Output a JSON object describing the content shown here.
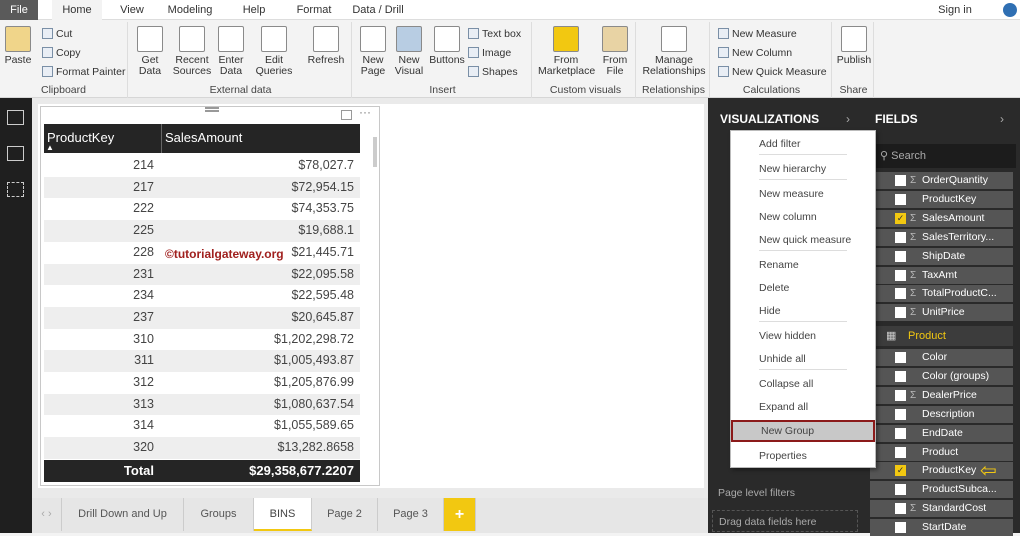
{
  "ribbon_tabs": [
    "File",
    "Home",
    "View",
    "Modeling",
    "Help",
    "Format",
    "Data / Drill"
  ],
  "sign_in": "Sign in",
  "clipboard": {
    "paste": "Paste",
    "cut": "Cut",
    "copy": "Copy",
    "format_painter": "Format Painter",
    "label": "Clipboard"
  },
  "external": {
    "get_data": "Get Data",
    "recent": "Recent Sources",
    "enter": "Enter Data",
    "edit": "Edit Queries",
    "refresh": "Refresh",
    "label": "External data"
  },
  "insert": {
    "new_page": "New Page",
    "new_visual": "New Visual",
    "buttons": "Buttons",
    "text_box": "Text box",
    "image": "Image",
    "shapes": "Shapes",
    "label": "Insert"
  },
  "custom": {
    "market": "From Marketplace",
    "file": "From File",
    "label": "Custom visuals"
  },
  "relationships": {
    "manage": "Manage Relationships",
    "label": "Relationships"
  },
  "calc": {
    "measure": "New Measure",
    "column": "New Column",
    "quick": "New Quick Measure",
    "label": "Calculations"
  },
  "share": {
    "publish": "Publish",
    "label": "Share"
  },
  "table": {
    "headers": [
      "ProductKey",
      "SalesAmount"
    ],
    "rows": [
      [
        "214",
        "$78,027.7"
      ],
      [
        "217",
        "$72,954.15"
      ],
      [
        "222",
        "$74,353.75"
      ],
      [
        "225",
        "$19,688.1"
      ],
      [
        "228",
        "$21,445.71"
      ],
      [
        "231",
        "$22,095.58"
      ],
      [
        "234",
        "$22,595.48"
      ],
      [
        "237",
        "$20,645.87"
      ],
      [
        "310",
        "$1,202,298.72"
      ],
      [
        "311",
        "$1,005,493.87"
      ],
      [
        "312",
        "$1,205,876.99"
      ],
      [
        "313",
        "$1,080,637.54"
      ],
      [
        "314",
        "$1,055,589.65"
      ],
      [
        "320",
        "$13,282.8658"
      ]
    ],
    "total_label": "Total",
    "total_value": "$29,358,677.2207"
  },
  "watermark": "©tutorialgateway.org",
  "page_tabs": [
    "Drill Down and Up",
    "Groups",
    "BINS",
    "Page 2",
    "Page 3",
    "+"
  ],
  "viz": {
    "title": "VISUALIZATIONS",
    "page_filters": "Page level filters",
    "drag": "Drag data fields here"
  },
  "fields": {
    "title": "FIELDS",
    "search_placeholder": "Search",
    "table_name": "Product",
    "items_a": [
      {
        "n": "OrderQuantity",
        "s": true,
        "c": false
      },
      {
        "n": "ProductKey",
        "s": false,
        "c": false
      },
      {
        "n": "SalesAmount",
        "s": true,
        "c": true
      },
      {
        "n": "SalesTerritory...",
        "s": true,
        "c": false
      },
      {
        "n": "ShipDate",
        "s": false,
        "c": false
      },
      {
        "n": "TaxAmt",
        "s": true,
        "c": false
      },
      {
        "n": "TotalProductC...",
        "s": true,
        "c": false
      },
      {
        "n": "UnitPrice",
        "s": true,
        "c": false
      }
    ],
    "items_b": [
      {
        "n": "Color",
        "s": false,
        "c": false
      },
      {
        "n": "Color (groups)",
        "s": false,
        "c": false
      },
      {
        "n": "DealerPrice",
        "s": true,
        "c": false
      },
      {
        "n": "Description",
        "s": false,
        "c": false
      },
      {
        "n": "EndDate",
        "s": false,
        "c": false
      },
      {
        "n": "Product",
        "s": false,
        "c": false
      },
      {
        "n": "ProductKey",
        "s": false,
        "c": true
      },
      {
        "n": "ProductSubca...",
        "s": false,
        "c": false
      },
      {
        "n": "StandardCost",
        "s": true,
        "c": false
      },
      {
        "n": "StartDate",
        "s": false,
        "c": false
      }
    ]
  },
  "menu": [
    "Add filter",
    "New hierarchy",
    "New measure",
    "New column",
    "New quick measure",
    "Rename",
    "Delete",
    "Hide",
    "View hidden",
    "Unhide all",
    "Collapse all",
    "Expand all",
    "New Group",
    "Properties"
  ],
  "colors": {
    "accent": "#f2c811",
    "highlight_border": "#8b1a1a"
  }
}
